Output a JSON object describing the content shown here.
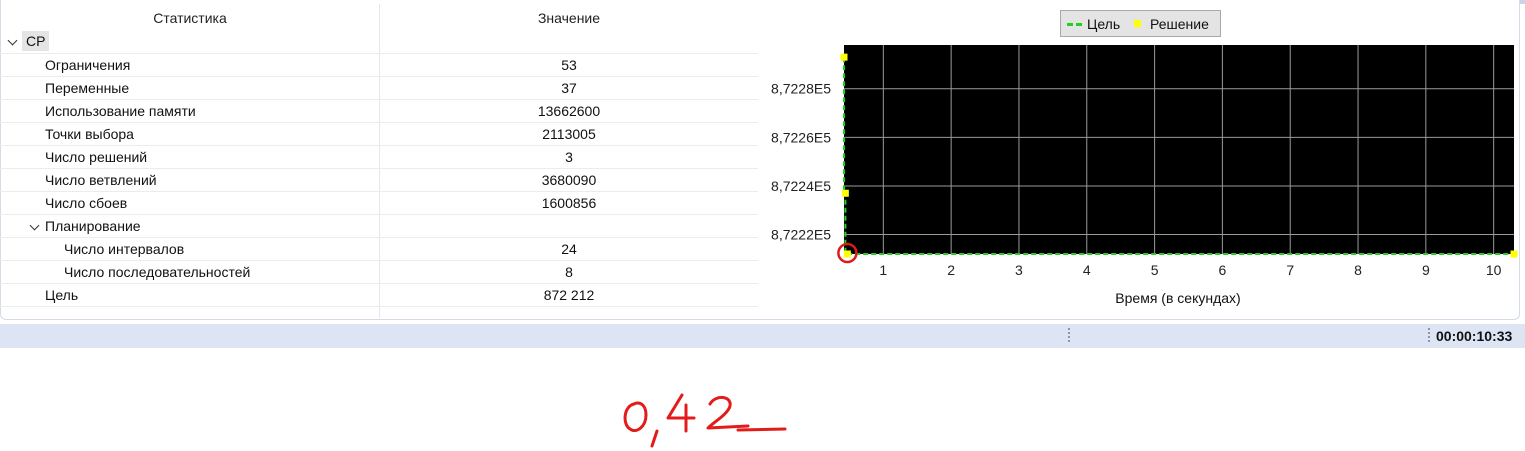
{
  "table": {
    "col_stat": "Статистика",
    "col_value": "Значение",
    "root_label": "CP",
    "rows": [
      {
        "label": "Ограничения",
        "value": "53"
      },
      {
        "label": "Переменные",
        "value": "37"
      },
      {
        "label": "Использование памяти",
        "value": "13662600"
      },
      {
        "label": "Точки выбора",
        "value": "2113005"
      },
      {
        "label": "Число решений",
        "value": "3"
      },
      {
        "label": "Число ветвлений",
        "value": "3680090"
      },
      {
        "label": "Число сбоев",
        "value": "1600856"
      },
      {
        "label": "Планирование",
        "value": ""
      },
      {
        "label": "Число интервалов",
        "value": "24"
      },
      {
        "label": "Число последовательностей",
        "value": "8"
      },
      {
        "label": "Цель",
        "value": "872 212"
      }
    ]
  },
  "chart_data": {
    "type": "line",
    "xlabel": "Время (в секундах)",
    "x_ticks": [
      1,
      2,
      3,
      4,
      5,
      6,
      7,
      8,
      9,
      10
    ],
    "y_ticks": [
      "8,7222E5",
      "8,7224E5",
      "8,7226E5",
      "8,7228E5"
    ],
    "y_tick_values": [
      872220,
      872240,
      872260,
      872280
    ],
    "xlim": [
      0.42,
      10.3
    ],
    "ylim": [
      872212,
      872298
    ],
    "background": "#000000",
    "legend_position": "top",
    "series": [
      {
        "name": "Цель",
        "color": "#22d01e",
        "style": "dashed",
        "x": [
          0.42,
          0.42,
          0.44,
          0.44,
          10.3
        ],
        "y": [
          872293,
          872237,
          872237,
          872212,
          872212
        ]
      },
      {
        "name": "Решение",
        "color": "#ffff00",
        "style": "markers",
        "x": [
          0.42,
          0.44,
          0.47,
          10.3
        ],
        "y": [
          872293,
          872237,
          872212,
          872212
        ]
      }
    ],
    "annotation": {
      "type": "circle",
      "color": "#dd1a1a",
      "x": 0.47,
      "y": 872212
    }
  },
  "statusbar": {
    "time": "00:00:10:33"
  },
  "handwritten_note": "0,42"
}
